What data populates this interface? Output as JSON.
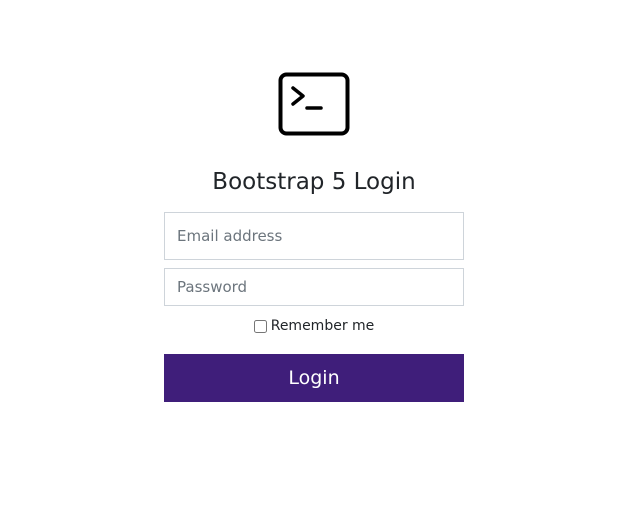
{
  "login": {
    "logo_icon": "terminal-icon",
    "title": "Bootstrap 5 Login",
    "email": {
      "placeholder": "Email address",
      "value": ""
    },
    "password": {
      "placeholder": "Password",
      "value": ""
    },
    "remember": {
      "label": "Remember me",
      "checked": false
    },
    "submit_label": "Login",
    "colors": {
      "primary": "#3f1e7a",
      "input_border": "#ced4da",
      "text": "#212529",
      "placeholder": "#6c757d"
    }
  }
}
